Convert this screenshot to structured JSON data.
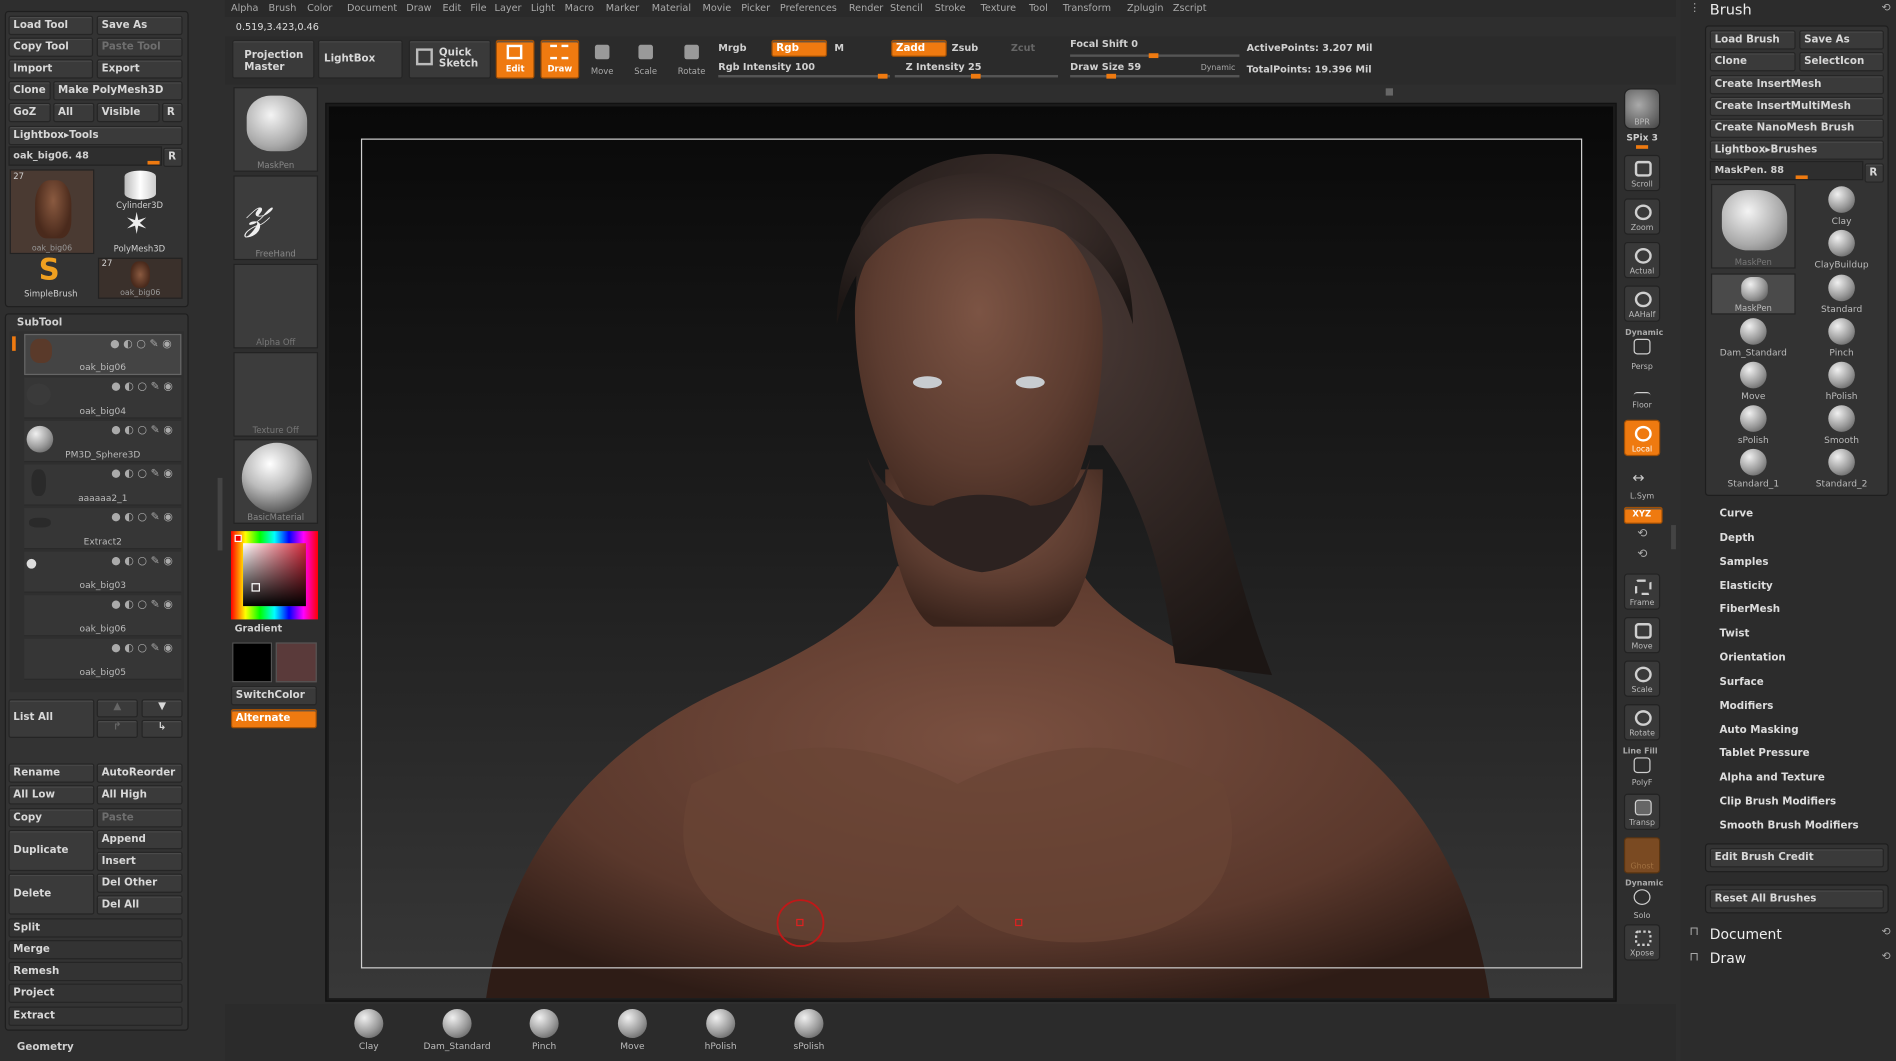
{
  "menu": [
    "Alpha",
    "Brush",
    "Color",
    "Document",
    "Draw",
    "Edit",
    "File",
    "Layer",
    "Light",
    "Macro",
    "Marker",
    "Material",
    "Movie",
    "Picker",
    "Preferences",
    "Render",
    "Stencil",
    "Stroke",
    "Texture",
    "Tool",
    "Transform",
    "Zplugin",
    "Zscript"
  ],
  "coords": "0.519,3.423,0.46",
  "toolbar": {
    "projection_master": "Projection Master",
    "lightbox": "LightBox",
    "quick_sketch": "Quick Sketch",
    "edit": "Edit",
    "draw": "Draw",
    "move": "Move",
    "scale": "Scale",
    "rotate": "Rotate",
    "mrgb": "Mrgb",
    "rgb": "Rgb",
    "m": "M",
    "rgb_intensity": "Rgb Intensity 100",
    "zadd": "Zadd",
    "zsub": "Zsub",
    "zcut": "Zcut",
    "z_intensity": "Z Intensity 25",
    "focal_shift": "Focal Shift 0",
    "draw_size": "Draw Size 59",
    "dynamic": "Dynamic",
    "active_points": "ActivePoints: 3.207 Mil",
    "total_points": "TotalPoints: 19.396 Mil"
  },
  "tool": {
    "load_tool": "Load Tool",
    "save_as": "Save As",
    "copy_tool": "Copy Tool",
    "paste_tool": "Paste Tool",
    "import": "Import",
    "export": "Export",
    "clone": "Clone",
    "make_polymesh": "Make PolyMesh3D",
    "goz": "GoZ",
    "all": "All",
    "visible": "Visible",
    "r": "R",
    "lightbox_tools": "Lightbox▸Tools",
    "current": "oak_big06. 48",
    "thumb_count_a": "27",
    "thumb_count_b": "27",
    "thumbs": [
      "oak_big06",
      "Cylinder3D",
      "PolyMesh3D",
      "SimpleBrush",
      "oak_big06"
    ]
  },
  "subtool": {
    "title": "SubTool",
    "items": [
      "oak_big06",
      "oak_big04",
      "PM3D_Sphere3D",
      "aaaaaa2_1",
      "Extract2",
      "oak_big03",
      "oak_big06",
      "oak_big05"
    ],
    "list_all": "List All",
    "rename": "Rename",
    "autoreorder": "AutoReorder",
    "all_low": "All Low",
    "all_high": "All High",
    "copy": "Copy",
    "paste": "Paste",
    "duplicate": "Duplicate",
    "append": "Append",
    "insert": "Insert",
    "delete": "Delete",
    "del_other": "Del Other",
    "del_all": "Del All",
    "split": "Split",
    "merge": "Merge",
    "remesh": "Remesh",
    "project": "Project",
    "extract": "Extract",
    "geometry": "Geometry"
  },
  "left_shelf": {
    "brush": "MaskPen",
    "stroke": "FreeHand",
    "alpha": "Alpha Off",
    "texture": "Texture Off",
    "material": "BasicMaterial",
    "gradient": "Gradient",
    "switch_color": "SwitchColor",
    "alternate": "Alternate"
  },
  "right_shelf": [
    "BPR",
    "SPix 3",
    "Scroll",
    "Zoom",
    "Actual",
    "AAHalf",
    "Persp",
    "Floor",
    "Local",
    "L.Sym",
    "XYZ",
    "Frame",
    "Move",
    "Scale",
    "Rotate",
    "PolyF",
    "Transp",
    "Ghost",
    "Solo",
    "Xpose"
  ],
  "right_shelf_extra": {
    "dynamic": "Dynamic",
    "line_fill": "Line Fill",
    "dynamic2": "Dynamic"
  },
  "brush_panel": {
    "title": "Brush",
    "load_brush": "Load Brush",
    "save_as": "Save As",
    "clone": "Clone",
    "selection": "SelectIcon",
    "create_insertmesh": "Create InsertMesh",
    "create_insertmultimesh": "Create InsertMultiMesh",
    "create_nanomesh": "Create NanoMesh Brush",
    "lightbox_brushes": "Lightbox▸Brushes",
    "current": "MaskPen. 88",
    "r": "R",
    "grid": [
      "Clay",
      "ClayBuildup",
      "MaskPen",
      "Standard",
      "Dam_Standard",
      "Pinch",
      "Move",
      "hPolish",
      "sPolish",
      "Smooth",
      "Standard_1",
      "Standard_2"
    ],
    "big_label": "MaskPen",
    "sections": [
      "Curve",
      "Depth",
      "Samples",
      "Elasticity",
      "FiberMesh",
      "Twist",
      "Orientation",
      "Surface",
      "Modifiers",
      "Auto Masking",
      "Tablet Pressure",
      "Alpha and Texture",
      "Clip Brush Modifiers",
      "Smooth Brush Modifiers"
    ],
    "edit_credit": "Edit Brush Credit",
    "reset_all": "Reset All Brushes",
    "document": "Document",
    "draw": "Draw"
  },
  "bottom_shelf": [
    "Clay",
    "Dam_Standard",
    "Pinch",
    "Move",
    "hPolish",
    "sPolish"
  ],
  "colors": {
    "accent": "#ef7a10",
    "bg": "#2e2e2e"
  }
}
